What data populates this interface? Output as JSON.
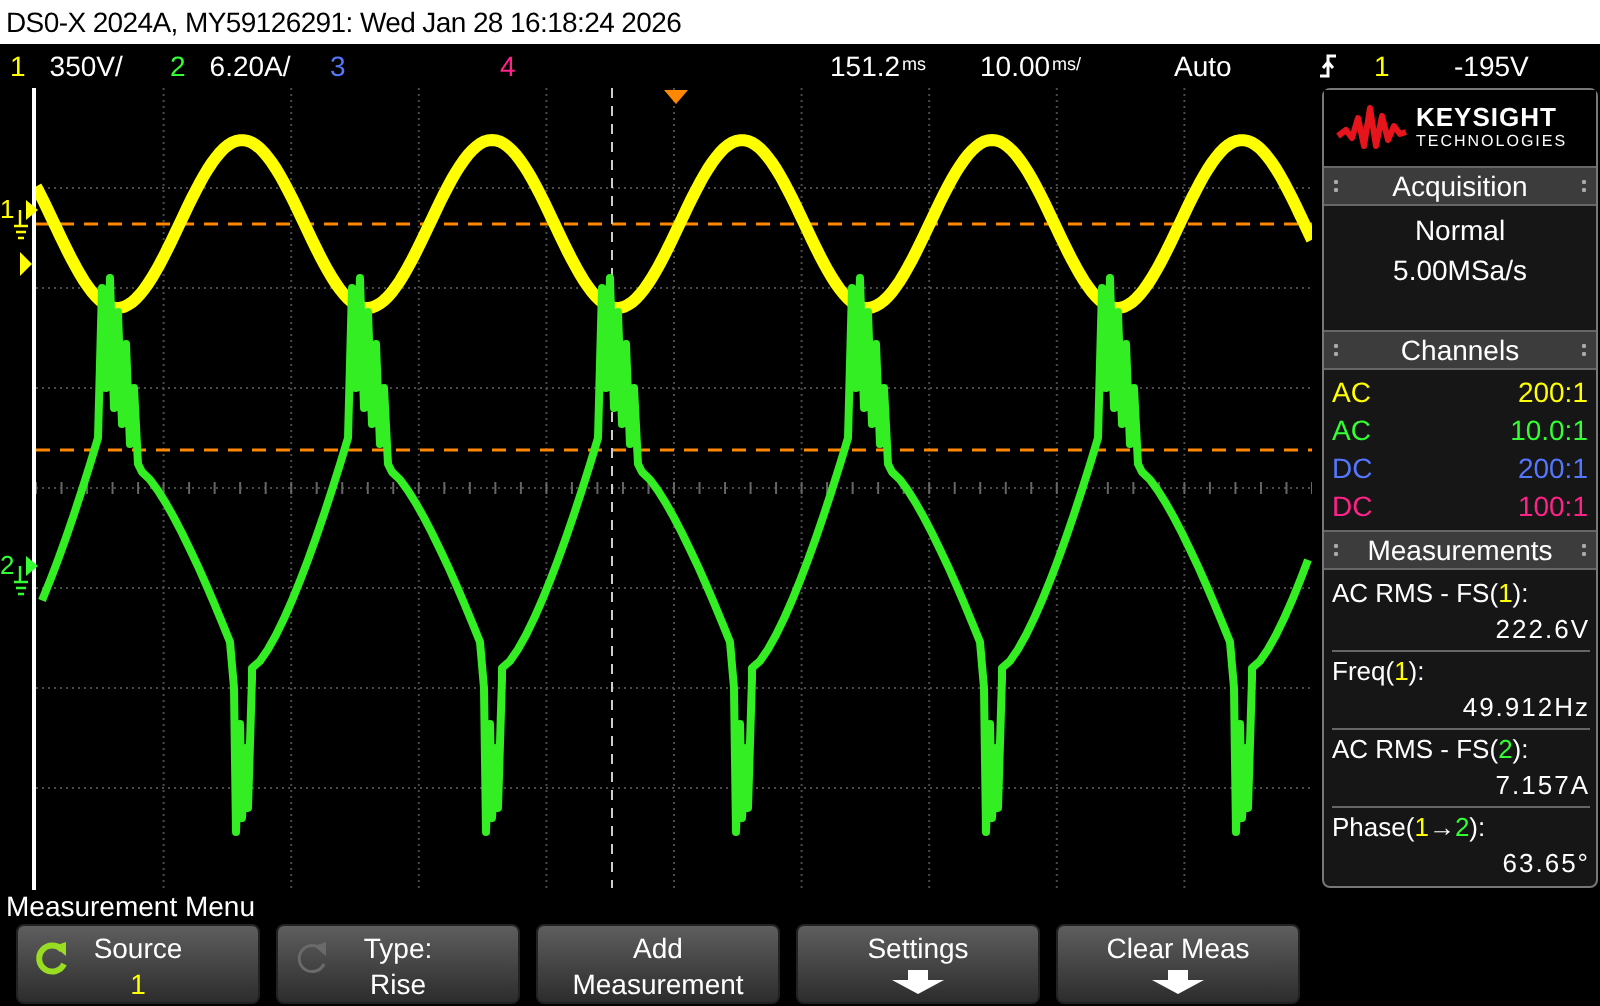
{
  "window": {
    "title": "DS0-X 2024A, MY59126291: Wed Jan 28 16:18:24 2026"
  },
  "status_bar": {
    "channels": [
      {
        "number": "1",
        "scale": "350V/",
        "color": "#ffff00"
      },
      {
        "number": "2",
        "scale": "6.20A/",
        "color": "#33ff33"
      },
      {
        "number": "3",
        "color": "#5577ff"
      },
      {
        "number": "4",
        "color": "#ff2288"
      }
    ],
    "delay": "151.2",
    "delay_unit": "ms",
    "timebase": "10.00",
    "timebase_unit": "ms/",
    "trigger_mode": "Auto",
    "trigger_source": {
      "label": "1",
      "color": "#ffff00"
    },
    "trigger_level": "-195V"
  },
  "display": {
    "markers": [
      {
        "kind": "ground",
        "label": "1",
        "color": "#ffff00"
      },
      {
        "kind": "trigger",
        "color": "#ffff00"
      },
      {
        "kind": "ground",
        "label": "2",
        "color": "#33ff33"
      }
    ]
  },
  "panel": {
    "brand": "KEYSIGHT",
    "brand_sub": "TECHNOLOGIES",
    "acquisition": {
      "title": "Acquisition",
      "mode": "Normal",
      "rate": "5.00MSa/s"
    },
    "channels": {
      "title": "Channels",
      "rows": [
        {
          "coupling": "AC",
          "probe": "200:1",
          "color": "#ffff00"
        },
        {
          "coupling": "AC",
          "probe": "10.0:1",
          "color": "#33ff33"
        },
        {
          "coupling": "DC",
          "probe": "200:1",
          "color": "#5577ff"
        },
        {
          "coupling": "DC",
          "probe": "100:1",
          "color": "#ff2288"
        }
      ]
    },
    "measurements": {
      "title": "Measurements",
      "items": [
        {
          "label": [
            {
              "text": "AC RMS - FS("
            },
            {
              "text": "1",
              "color": "#ffff00"
            },
            {
              "text": "):"
            }
          ],
          "value": "222.6V"
        },
        {
          "label": [
            {
              "text": "Freq("
            },
            {
              "text": "1",
              "color": "#ffff00"
            },
            {
              "text": "):"
            }
          ],
          "value": "49.912Hz"
        },
        {
          "label": [
            {
              "text": "AC RMS - FS("
            },
            {
              "text": "2",
              "color": "#33ff33"
            },
            {
              "text": "):"
            }
          ],
          "value": "7.157A"
        },
        {
          "label": [
            {
              "text": "Phase("
            },
            {
              "text": "1",
              "color": "#ffff00"
            },
            {
              "text": "→"
            },
            {
              "text": "2",
              "color": "#33ff33"
            },
            {
              "text": "):"
            }
          ],
          "value": "63.65°"
        }
      ]
    }
  },
  "menu": {
    "title": "Measurement Menu",
    "softkeys": [
      {
        "kind": "rotary",
        "disabled": false,
        "label": "Source",
        "value": "1",
        "color": "#ffff00"
      },
      {
        "kind": "rotary",
        "disabled": true,
        "label": "Type:",
        "value": "Rise"
      },
      {
        "kind": "plain",
        "label": "Add",
        "value": "Measurement"
      },
      {
        "kind": "submenu",
        "label": "Settings"
      },
      {
        "kind": "submenu",
        "label": "Clear Meas"
      }
    ]
  }
}
